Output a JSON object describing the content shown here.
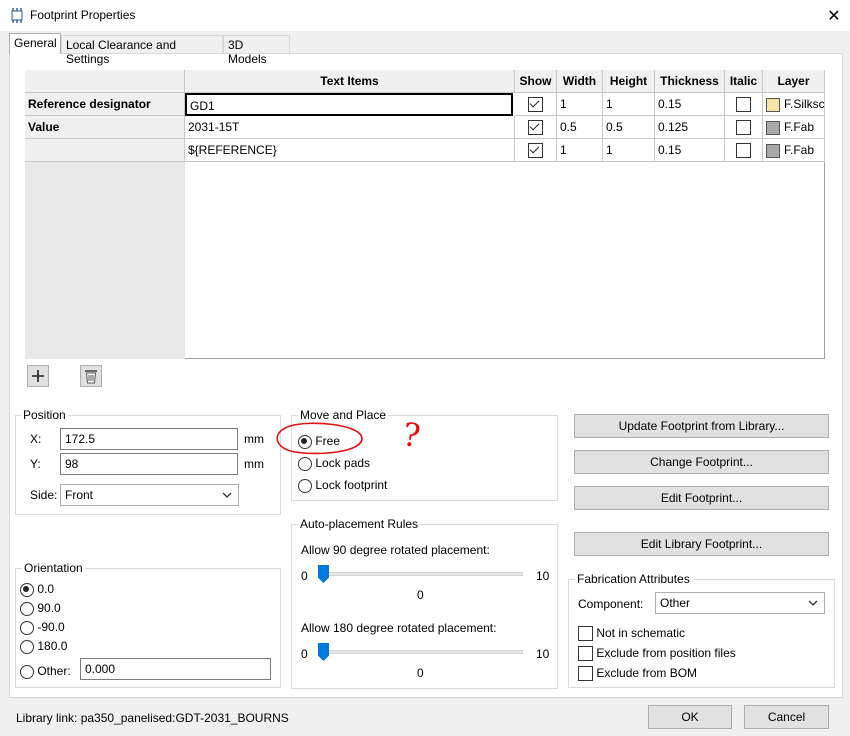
{
  "window": {
    "title": "Footprint Properties",
    "close_glyph": "✕"
  },
  "tabs": [
    {
      "label": "General",
      "active": true
    },
    {
      "label": "Local Clearance and Settings",
      "active": false
    },
    {
      "label": "3D Models",
      "active": false
    }
  ],
  "grid": {
    "columns": [
      "Text Items",
      "Show",
      "Width",
      "Height",
      "Thickness",
      "Italic",
      "Layer"
    ],
    "rows": [
      {
        "label": "Reference designator",
        "text": "GD1",
        "show": true,
        "width": "1",
        "height": "1",
        "thickness": "0.15",
        "italic": false,
        "layer": "F.Silksc",
        "layer_color": "#f5e6a8"
      },
      {
        "label": "Value",
        "text": "2031-15T",
        "show": true,
        "width": "0.5",
        "height": "0.5",
        "thickness": "0.125",
        "italic": false,
        "layer": "F.Fab",
        "layer_color": "#a8a8a8"
      },
      {
        "label": "",
        "text": "${REFERENCE}",
        "show": true,
        "width": "1",
        "height": "1",
        "thickness": "0.15",
        "italic": false,
        "layer": "F.Fab",
        "layer_color": "#a8a8a8"
      }
    ],
    "add_icon": "plus-icon",
    "delete_icon": "trash-icon"
  },
  "position": {
    "label": "Position",
    "x_label": "X:",
    "x_value": "172.5",
    "x_unit": "mm",
    "y_label": "Y:",
    "y_value": "98",
    "y_unit": "mm",
    "side_label": "Side:",
    "side_value": "Front"
  },
  "move_place": {
    "label": "Move and Place",
    "options": [
      "Free",
      "Lock pads",
      "Lock footprint"
    ],
    "selected": "Free"
  },
  "buttons": {
    "update": "Update Footprint from Library...",
    "change": "Change Footprint...",
    "edit": "Edit Footprint...",
    "edit_library": "Edit Library Footprint...",
    "ok": "OK",
    "cancel": "Cancel"
  },
  "orientation": {
    "label": "Orientation",
    "options": [
      "0.0",
      "90.0",
      "-90.0",
      "180.0"
    ],
    "selected": "0.0",
    "other_label": "Other:",
    "other_value": "0.000"
  },
  "autoplace": {
    "label": "Auto-placement Rules",
    "rot90_label": "Allow 90 degree rotated placement:",
    "rot90_min": "0",
    "rot90_max": "10",
    "rot90_value": "0",
    "rot90_fraction": 0,
    "rot180_label": "Allow 180 degree rotated placement:",
    "rot180_min": "0",
    "rot180_max": "10",
    "rot180_value": "0",
    "rot180_fraction": 0
  },
  "fabrication": {
    "label": "Fabrication Attributes",
    "component_label": "Component:",
    "component_value": "Other",
    "checks": [
      {
        "label": "Not in schematic",
        "checked": false
      },
      {
        "label": "Exclude from position files",
        "checked": false
      },
      {
        "label": "Exclude from BOM",
        "checked": false
      }
    ]
  },
  "footer": {
    "library_link": "Library link:  pa350_panelised:GDT-2031_BOURNS"
  },
  "annotation": {
    "mark": "?",
    "color": "#e01010"
  }
}
